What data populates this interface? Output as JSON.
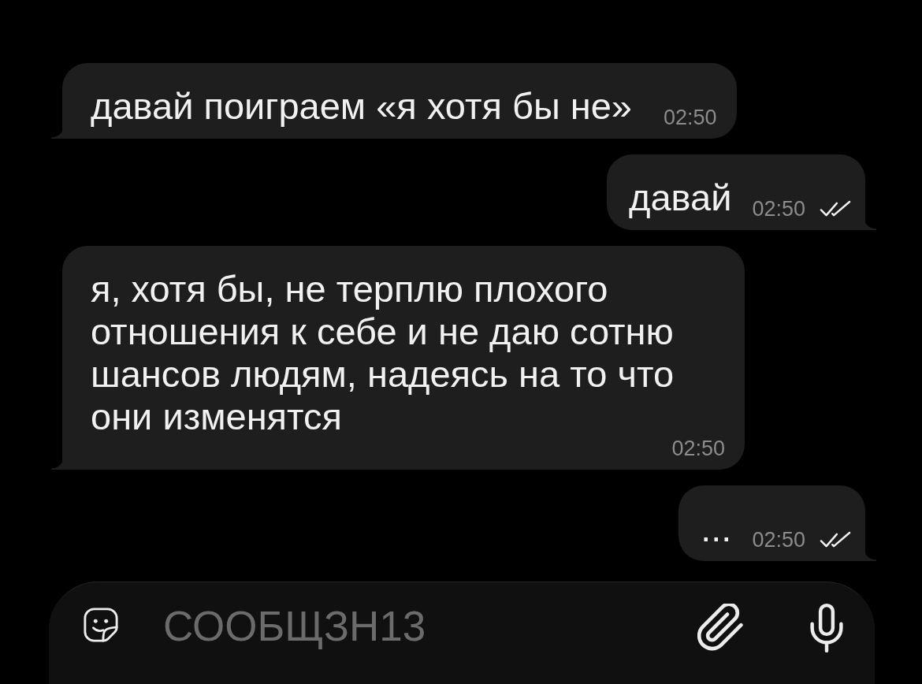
{
  "messages": [
    {
      "kind": "incoming",
      "text": "давай поиграем «я хотя бы не»",
      "time": "02:50"
    },
    {
      "kind": "outgoing",
      "text": "давай",
      "time": "02:50",
      "read": true
    },
    {
      "kind": "incoming",
      "text": "я, хотя бы, не терплю плохого отношения к себе и не даю сотню шансов людям, надеясь на то что они изменятся",
      "time": "02:50"
    },
    {
      "kind": "outgoing",
      "text": "...",
      "time": "02:50",
      "read": true
    }
  ],
  "composer": {
    "placeholder": "СООБЩЗН13"
  }
}
